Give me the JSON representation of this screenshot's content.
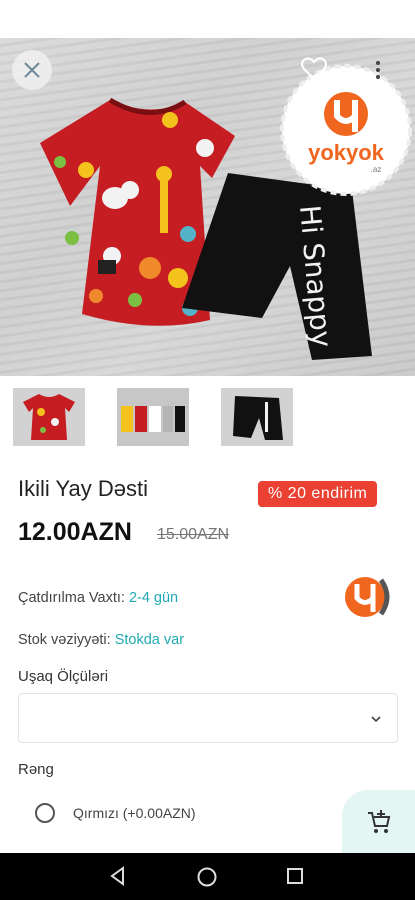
{
  "product": {
    "title": "Ikili Yay Dəsti",
    "discount_label": "% 20 endirim",
    "price": "12.00AZN",
    "old_price": "15.00AZN"
  },
  "info": {
    "delivery_label": "Çatdırılma Vaxtı:",
    "delivery_value": "2-4 gün",
    "stock_label": "Stok vəziyyəti:",
    "stock_value": "Stokda var"
  },
  "brand": {
    "logo_text": "yokyok",
    "logo_sub": ".az"
  },
  "print_text": "Hi Snappy",
  "sizes": {
    "label": "Uşaq Ölçüləri",
    "selected": ""
  },
  "colors": {
    "label": "Rəng",
    "options": [
      {
        "label": "Qırmızı (+0.00AZN)",
        "selected": false
      }
    ]
  },
  "icons": {
    "close": "close-icon",
    "favorite": "heart-icon",
    "more": "more-vert-icon",
    "chevron": "chevron-down-icon",
    "cart": "add-to-cart-icon",
    "nav_back": "back-triangle-icon",
    "nav_home": "home-circle-icon",
    "nav_recent": "recent-square-icon"
  },
  "colors_theme": {
    "accent": "#21a9b3",
    "discount_bg": "#ea4133",
    "brand_orange": "#f0661e",
    "cart_bg": "#e3f6f4"
  }
}
